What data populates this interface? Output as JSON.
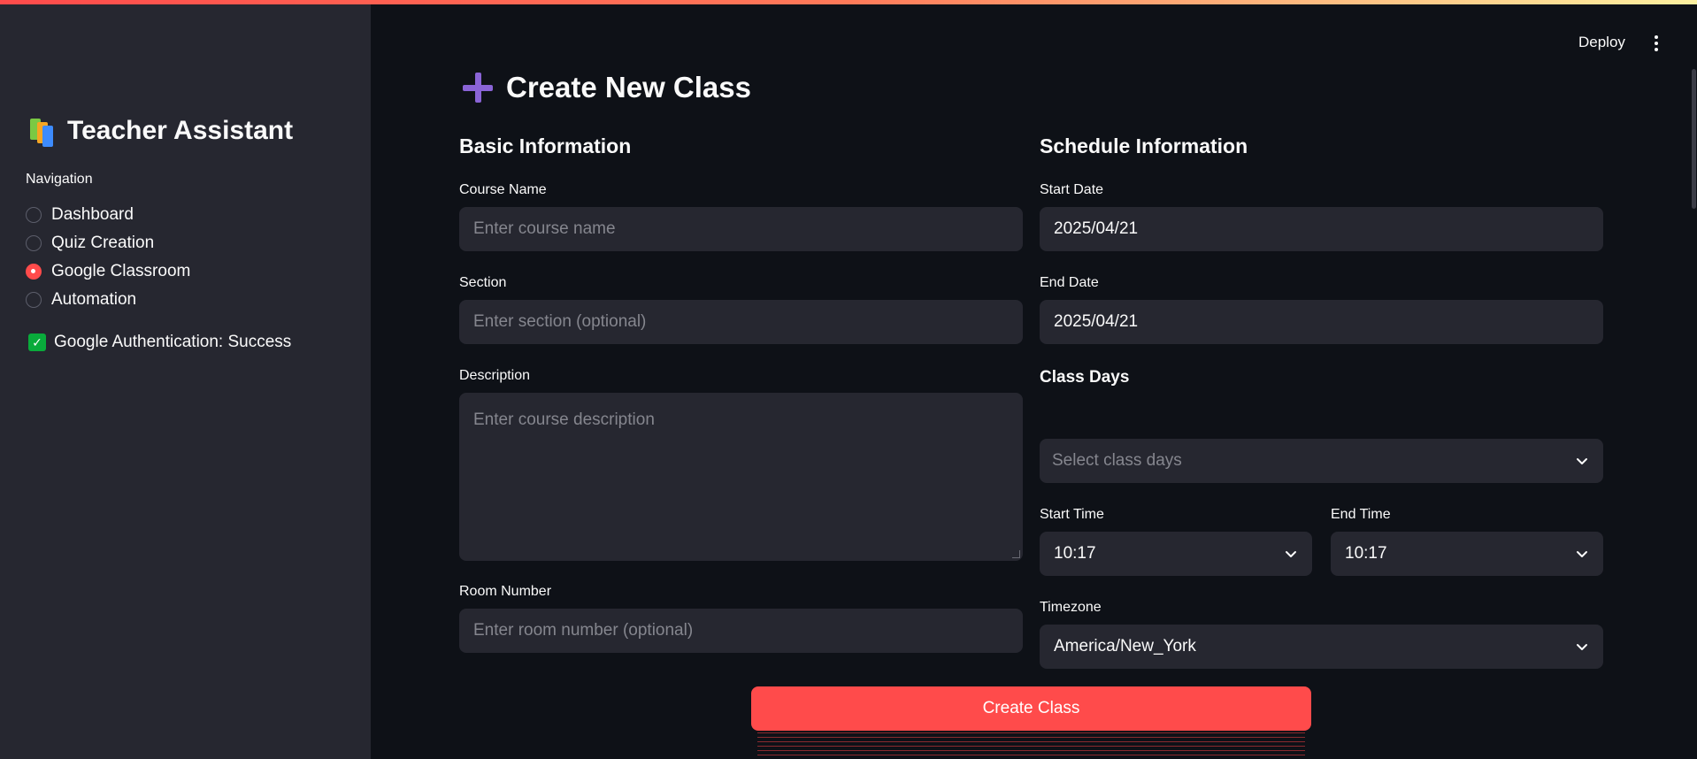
{
  "sidebar": {
    "app_title": "Teacher Assistant",
    "app_icon": "books-icon",
    "nav_label": "Navigation",
    "nav_items": [
      {
        "label": "Dashboard",
        "selected": false
      },
      {
        "label": "Quiz Creation",
        "selected": false
      },
      {
        "label": "Google Classroom",
        "selected": true
      },
      {
        "label": "Automation",
        "selected": false
      }
    ],
    "auth_status": "Google Authentication: Success",
    "auth_icon": "check-icon"
  },
  "header": {
    "deploy_label": "Deploy",
    "menu_icon": "kebab-menu-icon"
  },
  "main": {
    "page_title": "Create New Class",
    "page_icon": "plus-icon",
    "basic": {
      "title": "Basic Information",
      "course_name_label": "Course Name",
      "course_name_placeholder": "Enter course name",
      "section_label": "Section",
      "section_placeholder": "Enter section (optional)",
      "description_label": "Description",
      "description_placeholder": "Enter course description",
      "room_label": "Room Number",
      "room_placeholder": "Enter room number (optional)"
    },
    "schedule": {
      "title": "Schedule Information",
      "start_date_label": "Start Date",
      "start_date_value": "2025/04/21",
      "end_date_label": "End Date",
      "end_date_value": "2025/04/21",
      "class_days_heading": "Class Days",
      "class_days_placeholder": "Select class days",
      "start_time_label": "Start Time",
      "start_time_value": "10:17",
      "end_time_label": "End Time",
      "end_time_value": "10:17",
      "timezone_label": "Timezone",
      "timezone_value": "America/New_York"
    },
    "create_button": "Create Class"
  },
  "colors": {
    "accent": "#ff4b4b",
    "background": "#0e1117",
    "sidebar": "#262730",
    "success": "#09ab3b",
    "plus_icon": "#8a64d6"
  }
}
